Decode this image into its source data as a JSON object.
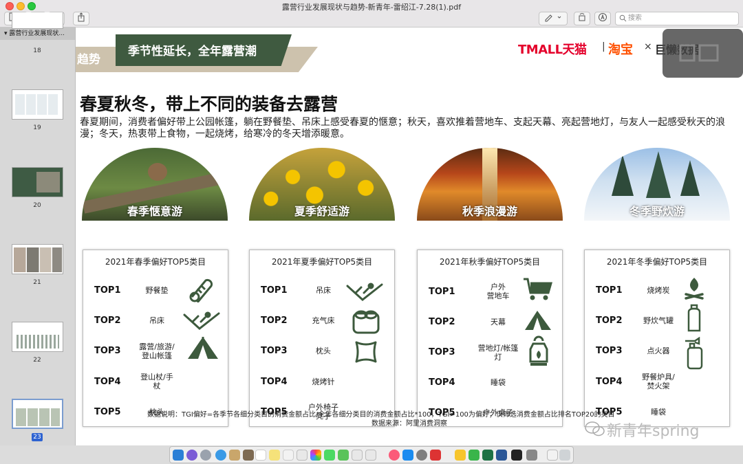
{
  "window": {
    "title": "露营行业发展现状与趋势-新青年-雷绍江-7.28(1).pdf",
    "search_placeholder": "搜索"
  },
  "sidebar": {
    "header": "露营行业发展现状...",
    "pages": [
      "18",
      "19",
      "20",
      "21",
      "22",
      "23"
    ],
    "selected_page": "23"
  },
  "slide": {
    "trend_tab": "趋势",
    "banner": "季节性延长，全年露营潮",
    "brand_tmall": "TMALL天猫",
    "brand_sep1": "|",
    "brand_taobao": "淘宝",
    "brand_x": "×",
    "brand_partner": "巨懒数据",
    "brand_partner2": "洞察",
    "heading": "春夏秋冬，带上不同的装备去露营",
    "intro": "春夏期间，消费者偏好带上公园帐篷，躺在野餐垫、吊床上感受春夏的惬意；秋天，喜欢推着营地车、支起天幕、亮起营地灯，与友人一起感受秋天的浪漫；冬天，热衷带上食物，一起烧烤，给寒冷的冬天增添暖意。",
    "footnote": "数据说明：TGI偏好=各季节各细分类目的消费金额占比/全年各细分类目的消费金额占比*100，TGI>100为偏好；仅筛选消费金额占比排名TOP20的类目",
    "source": "数据来源：阿里消费洞察",
    "watermark": "新青年spring"
  },
  "seasons": [
    {
      "label": "春季惬意游",
      "title": "2021年春季偏好TOP5类目",
      "rows": [
        {
          "rank": "TOP1",
          "item": "野餐垫",
          "icon": "picnic-mat-icon"
        },
        {
          "rank": "TOP2",
          "item": "吊床",
          "icon": "hammock-icon"
        },
        {
          "rank": "TOP3",
          "item": "露营/旅游/\n登山帐篷",
          "icon": "tent-icon"
        },
        {
          "rank": "TOP4",
          "item": "登山杖/手\n杖",
          "icon": ""
        },
        {
          "rank": "TOP5",
          "item": "枕头",
          "icon": ""
        }
      ]
    },
    {
      "label": "夏季舒适游",
      "title": "2021年夏季偏好TOP5类目",
      "rows": [
        {
          "rank": "TOP1",
          "item": "吊床",
          "icon": "hammock-icon"
        },
        {
          "rank": "TOP2",
          "item": "充气床",
          "icon": "air-bed-icon"
        },
        {
          "rank": "TOP3",
          "item": "枕头",
          "icon": "pillow-icon"
        },
        {
          "rank": "TOP4",
          "item": "烧烤针",
          "icon": ""
        },
        {
          "rank": "TOP5",
          "item": "户外椅子\n凳子",
          "icon": ""
        }
      ]
    },
    {
      "label": "秋季浪漫游",
      "title": "2021年秋季偏好TOP5类目",
      "rows": [
        {
          "rank": "TOP1",
          "item": "户外\n营地车",
          "icon": "cart-icon"
        },
        {
          "rank": "TOP2",
          "item": "天幕",
          "icon": "canopy-icon"
        },
        {
          "rank": "TOP3",
          "item": "营地灯/帐篷\n灯",
          "icon": "lantern-icon"
        },
        {
          "rank": "TOP4",
          "item": "睡袋",
          "icon": ""
        },
        {
          "rank": "TOP5",
          "item": "户外桌子",
          "icon": ""
        }
      ]
    },
    {
      "label": "冬季野炊游",
      "title": "2021年冬季偏好TOP5类目",
      "rows": [
        {
          "rank": "TOP1",
          "item": "烧烤炭",
          "icon": "campfire-icon"
        },
        {
          "rank": "TOP2",
          "item": "野炊气罐",
          "icon": "gas-canister-icon"
        },
        {
          "rank": "TOP3",
          "item": "点火器",
          "icon": "igniter-icon"
        },
        {
          "rank": "TOP4",
          "item": "野餐炉具/\n焚火架",
          "icon": ""
        },
        {
          "rank": "TOP5",
          "item": "睡袋",
          "icon": ""
        }
      ]
    }
  ],
  "colors": {
    "banner_green": "#3f5a40",
    "icon_green": "#3d5a3d",
    "tmall_red": "#e4002b",
    "taobao_orange": "#ff5000"
  }
}
